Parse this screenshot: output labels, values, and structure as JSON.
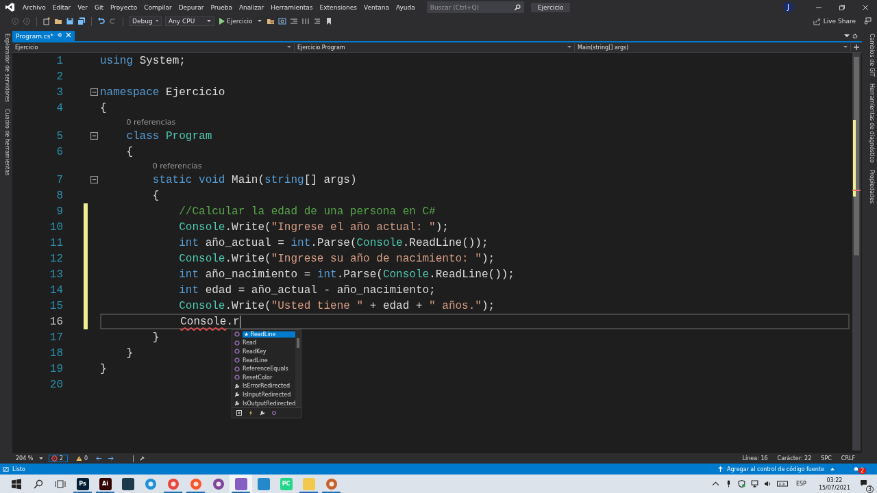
{
  "menu": [
    "Archivo",
    "Editar",
    "Ver",
    "Git",
    "Proyecto",
    "Compilar",
    "Depurar",
    "Prueba",
    "Analizar",
    "Herramientas",
    "Extensiones",
    "Ventana",
    "Ayuda"
  ],
  "search": {
    "placeholder": "Buscar (Ctrl+Q)"
  },
  "solution_title": "Ejercicio",
  "avatar": "J",
  "toolbar": {
    "configuration": "Debug",
    "platform": "Any CPU",
    "start": "Ejercicio",
    "live_share": "Live Share"
  },
  "left_tabs": [
    "Explorador de servidores",
    "Cuadro de herramientas"
  ],
  "right_tabs": [
    "Cambios de GIT",
    "Herramientas de diagnóstico",
    "Propiedades"
  ],
  "doc_tabs": [
    {
      "label": "Program.cs*",
      "selected": true
    }
  ],
  "nav": {
    "project": "Ejercicio",
    "type": "Ejercicio.Program",
    "member": "Main(string[] args)"
  },
  "lines": [
    {
      "n": "1",
      "fold": false,
      "changed": false,
      "current": false,
      "tokens": [
        {
          "kind": "kw",
          "t": "using"
        },
        {
          "kind": "plain",
          "t": " System;"
        }
      ]
    },
    {
      "n": "2",
      "fold": false,
      "changed": false,
      "current": false
    },
    {
      "n": "3",
      "fold": true,
      "changed": false,
      "current": false,
      "tokens": [
        {
          "kind": "kw",
          "t": "namespace"
        },
        {
          "kind": "plain",
          "t": " Ejercicio"
        }
      ]
    },
    {
      "n": "4",
      "fold": false,
      "changed": false,
      "current": false,
      "tokens": [
        {
          "kind": "plain",
          "t": "{"
        }
      ]
    },
    {
      "n": "5",
      "fold": true,
      "changed": false,
      "current": false,
      "codelens": "0 referencias",
      "tokens": [
        {
          "kind": "kw",
          "t": "    class "
        },
        {
          "kind": "type",
          "t": "Program"
        }
      ]
    },
    {
      "n": "6",
      "fold": false,
      "changed": false,
      "current": false,
      "tokens": [
        {
          "kind": "plain",
          "t": "    {"
        }
      ]
    },
    {
      "n": "7",
      "fold": true,
      "changed": false,
      "current": false,
      "codelens": "0 referencias",
      "tokens": [
        {
          "kind": "kw",
          "t": "        static void"
        },
        {
          "kind": "plain",
          "t": " Main("
        },
        {
          "kind": "kw",
          "t": "string"
        },
        {
          "kind": "plain",
          "t": "[] args)"
        }
      ]
    },
    {
      "n": "8",
      "fold": false,
      "changed": false,
      "current": false,
      "tokens": [
        {
          "kind": "plain",
          "t": "        {"
        }
      ]
    },
    {
      "n": "9",
      "fold": false,
      "changed": true,
      "current": false,
      "tokens": [
        {
          "kind": "comment",
          "t": "            //Calcular la edad de una persona en C#"
        }
      ]
    },
    {
      "n": "10",
      "fold": false,
      "changed": true,
      "current": false,
      "tokens": [
        {
          "kind": "type",
          "t": "            Console"
        },
        {
          "kind": "plain",
          "t": ".Write("
        },
        {
          "kind": "str",
          "t": "\"Ingrese el año actual: \""
        },
        {
          "kind": "plain",
          "t": ");"
        }
      ]
    },
    {
      "n": "11",
      "fold": false,
      "changed": true,
      "current": false,
      "tokens": [
        {
          "kind": "kw",
          "t": "            int"
        },
        {
          "kind": "plain",
          "t": " año_actual = "
        },
        {
          "kind": "kw",
          "t": "int"
        },
        {
          "kind": "plain",
          "t": ".Parse("
        },
        {
          "kind": "type",
          "t": "Console"
        },
        {
          "kind": "plain",
          "t": ".ReadLine());"
        }
      ]
    },
    {
      "n": "12",
      "fold": false,
      "changed": true,
      "current": false,
      "tokens": [
        {
          "kind": "type",
          "t": "            Console"
        },
        {
          "kind": "plain",
          "t": ".Write("
        },
        {
          "kind": "str",
          "t": "\"Ingrese su año de nacimiento: \""
        },
        {
          "kind": "plain",
          "t": ");"
        }
      ]
    },
    {
      "n": "13",
      "fold": false,
      "changed": true,
      "current": false,
      "tokens": [
        {
          "kind": "kw",
          "t": "            int"
        },
        {
          "kind": "plain",
          "t": " año_nacimiento = "
        },
        {
          "kind": "kw",
          "t": "int"
        },
        {
          "kind": "plain",
          "t": ".Parse("
        },
        {
          "kind": "type",
          "t": "Console"
        },
        {
          "kind": "plain",
          "t": ".ReadLine());"
        }
      ]
    },
    {
      "n": "14",
      "fold": false,
      "changed": true,
      "current": false,
      "tokens": [
        {
          "kind": "kw",
          "t": "            int"
        },
        {
          "kind": "plain",
          "t": " edad = año_actual - año_nacimiento;"
        }
      ]
    },
    {
      "n": "15",
      "fold": false,
      "changed": true,
      "current": false,
      "tokens": [
        {
          "kind": "type",
          "t": "            Console"
        },
        {
          "kind": "plain",
          "t": ".Write("
        },
        {
          "kind": "str",
          "t": "\"Usted tiene \""
        },
        {
          "kind": "plain",
          "t": " + edad + "
        },
        {
          "kind": "str",
          "t": "\" años.\""
        },
        {
          "kind": "plain",
          "t": ");"
        }
      ]
    },
    {
      "n": "16",
      "fold": false,
      "changed": true,
      "current": true,
      "tokens": [
        {
          "kind": "error",
          "t": "            Console"
        },
        {
          "kind": "plain",
          "t": ".r"
        }
      ]
    },
    {
      "n": "17",
      "fold": false,
      "changed": false,
      "current": false,
      "tokens": [
        {
          "kind": "plain",
          "t": "        }"
        }
      ]
    },
    {
      "n": "18",
      "fold": false,
      "changed": false,
      "current": false,
      "tokens": [
        {
          "kind": "plain",
          "t": "    }"
        }
      ]
    },
    {
      "n": "19",
      "fold": false,
      "changed": false,
      "current": false,
      "tokens": [
        {
          "kind": "plain",
          "t": "}"
        }
      ]
    },
    {
      "n": "20",
      "fold": false,
      "changed": false,
      "current": false
    }
  ],
  "completion": [
    {
      "label": "★ ReadLine",
      "kind": "method",
      "selected": true
    },
    {
      "label": "Read",
      "kind": "method",
      "selected": false
    },
    {
      "label": "ReadKey",
      "kind": "method",
      "selected": false
    },
    {
      "label": "ReadLine",
      "kind": "method",
      "selected": false
    },
    {
      "label": "ReferenceEquals",
      "kind": "method",
      "selected": false
    },
    {
      "label": "ResetColor",
      "kind": "method",
      "selected": false
    },
    {
      "label": "IsErrorRedirected",
      "kind": "property",
      "selected": false
    },
    {
      "label": "IsInputRedirected",
      "kind": "property",
      "selected": false
    },
    {
      "label": "IsOutputRedirected",
      "kind": "property",
      "selected": false
    }
  ],
  "editor_status": {
    "zoom": "204 %",
    "errors": "2",
    "warnings": "0",
    "line": "Línea: 16",
    "column": "Carácter: 22",
    "whitespace": "SPC",
    "line_endings": "CRLF"
  },
  "status_bar": {
    "text": "Listo",
    "source_control": "Agregar al control de código fuente",
    "notifications": "2"
  },
  "taskbar": {
    "apps": [
      {
        "kind": "tile",
        "color": "#001e36",
        "label": "Ps",
        "running": true,
        "selected": false
      },
      {
        "kind": "tile",
        "color": "#330000",
        "label": "Ai",
        "running": true,
        "selected": false
      },
      {
        "kind": "tile",
        "color": "#1b3a4b",
        "running": false,
        "selected": false
      },
      {
        "kind": "circle",
        "color": "#1f8fd6",
        "running": false,
        "selected": false
      },
      {
        "kind": "circle",
        "color": "#e8453c",
        "running": true,
        "selected": false
      },
      {
        "kind": "circle",
        "color": "#fb542b",
        "running": true,
        "selected": false
      },
      {
        "kind": "circle",
        "color": "#7d4698",
        "running": false,
        "selected": false
      },
      {
        "kind": "tile",
        "color": "#865fc5",
        "running": true,
        "selected": true
      },
      {
        "kind": "tile",
        "color": "#2489ca",
        "running": false,
        "selected": false
      },
      {
        "kind": "tile",
        "color": "#21d789",
        "label": "PC",
        "running": false,
        "selected": false
      },
      {
        "kind": "tile",
        "color": "#f2c94c",
        "running": true,
        "selected": false
      },
      {
        "kind": "circle",
        "color": "#c8602b",
        "running": true,
        "selected": false
      }
    ],
    "language": "ESP",
    "time": "03:22",
    "date": "15/07/2021",
    "notifications": "3"
  }
}
